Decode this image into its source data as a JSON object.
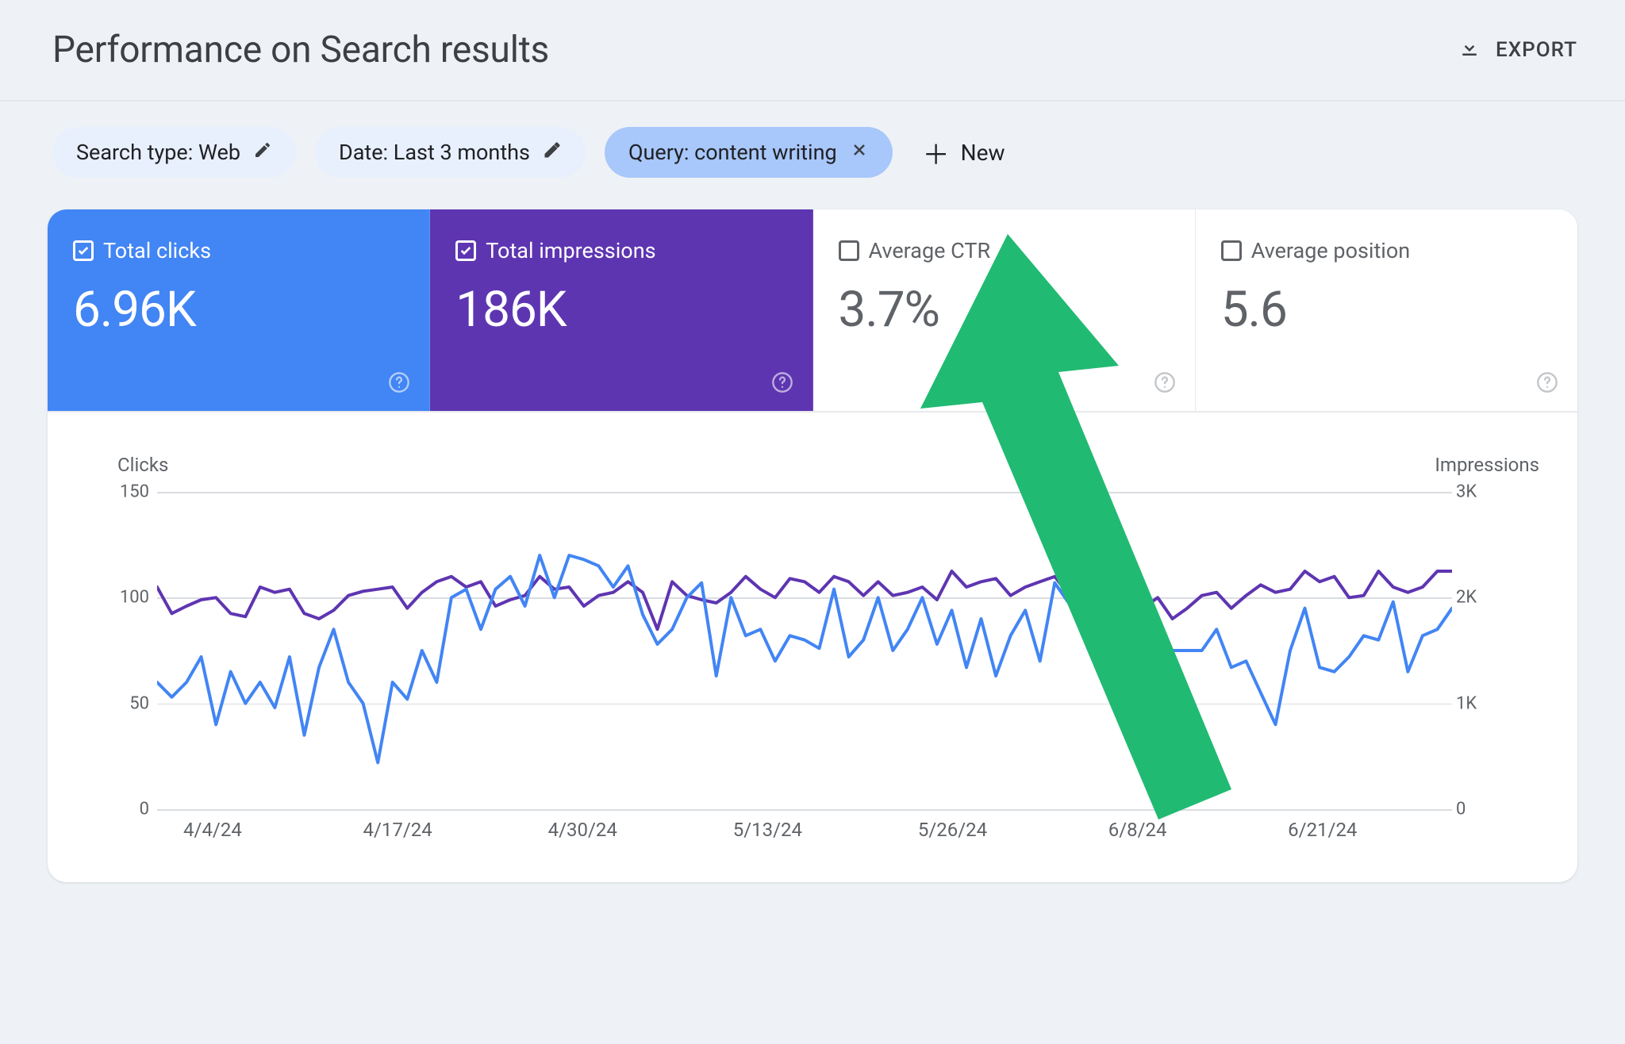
{
  "header": {
    "title": "Performance on Search results",
    "export_label": "EXPORT"
  },
  "filters": {
    "search_type": {
      "label": "Search type: Web"
    },
    "date": {
      "label": "Date: Last 3 months"
    },
    "query": {
      "label": "Query: content writing"
    },
    "new_label": "New"
  },
  "metrics": {
    "clicks": {
      "label": "Total clicks",
      "value": "6.96K",
      "active": true
    },
    "impressions": {
      "label": "Total impressions",
      "value": "186K",
      "active": true
    },
    "ctr": {
      "label": "Average CTR",
      "value": "3.7%",
      "active": false
    },
    "position": {
      "label": "Average position",
      "value": "5.6",
      "active": false
    }
  },
  "chart": {
    "left_axis_title": "Clicks",
    "right_axis_title": "Impressions",
    "left_ticks": [
      "0",
      "50",
      "100",
      "150"
    ],
    "right_ticks": [
      "0",
      "1K",
      "2K",
      "3K"
    ],
    "x_ticks": [
      "4/4/24",
      "4/17/24",
      "4/30/24",
      "5/13/24",
      "5/26/24",
      "6/8/24",
      "6/21/24"
    ],
    "colors": {
      "clicks": "#4285f4",
      "impressions": "#5e35b1"
    }
  },
  "chart_data": {
    "type": "line",
    "xlabel": "",
    "left": {
      "label": "Clicks",
      "ylim": [
        0,
        150
      ]
    },
    "right": {
      "label": "Impressions",
      "ylim": [
        0,
        3000
      ]
    },
    "x_tick_labels": [
      "4/4/24",
      "4/17/24",
      "4/30/24",
      "5/13/24",
      "5/26/24",
      "6/8/24",
      "6/21/24"
    ],
    "series": [
      {
        "name": "Clicks",
        "axis": "left",
        "color": "#4285f4",
        "values": [
          60,
          53,
          60,
          72,
          40,
          65,
          50,
          60,
          48,
          72,
          35,
          67,
          85,
          60,
          50,
          22,
          60,
          52,
          75,
          60,
          100,
          104,
          85,
          104,
          110,
          96,
          120,
          100,
          120,
          118,
          115,
          105,
          115,
          92,
          78,
          85,
          100,
          107,
          63,
          100,
          82,
          85,
          70,
          82,
          80,
          76,
          104,
          72,
          80,
          100,
          75,
          85,
          100,
          78,
          94,
          67,
          90,
          63,
          82,
          94,
          70,
          107,
          97,
          107,
          78,
          90,
          90,
          70,
          60,
          75,
          75,
          75,
          85,
          67,
          70,
          55,
          40,
          75,
          95,
          67,
          65,
          72,
          82,
          80,
          98,
          65,
          82,
          85,
          95
        ]
      },
      {
        "name": "Impressions",
        "axis": "right",
        "color": "#5e35b1",
        "values": [
          2100,
          1850,
          1920,
          1980,
          2000,
          1850,
          1820,
          2100,
          2050,
          2080,
          1850,
          1800,
          1880,
          2020,
          2060,
          2080,
          2100,
          1900,
          2050,
          2150,
          2200,
          2100,
          2150,
          1920,
          1980,
          2020,
          2200,
          2080,
          2100,
          1920,
          2020,
          2050,
          2150,
          2050,
          1700,
          2150,
          2020,
          1980,
          1950,
          2050,
          2200,
          2080,
          2000,
          2180,
          2150,
          2050,
          2200,
          2150,
          2020,
          2150,
          2020,
          2050,
          2100,
          1980,
          2250,
          2100,
          2150,
          2180,
          2020,
          2100,
          2150,
          2200,
          2020,
          2100,
          2100,
          2150,
          2000,
          1900,
          2000,
          1800,
          1900,
          2020,
          2050,
          1900,
          2020,
          2120,
          2050,
          2080,
          2250,
          2150,
          2200,
          2000,
          2020,
          2250,
          2100,
          2050,
          2100,
          2250,
          2250
        ]
      }
    ]
  }
}
